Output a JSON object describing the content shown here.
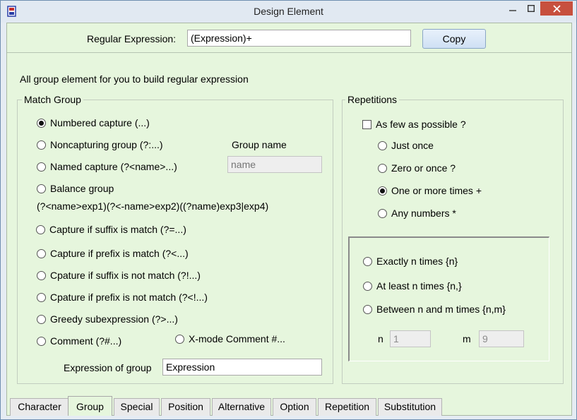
{
  "window": {
    "title": "Design Element"
  },
  "top": {
    "regex_label": "Regular Expression:",
    "regex_value": "(Expression)+",
    "copy_label": "Copy"
  },
  "intro": "All group element for you to build regular expression",
  "match_group": {
    "title": "Match Group",
    "options": [
      {
        "label": "Numbered capture  (...)",
        "checked": true
      },
      {
        "label": "Noncapturing group  (?:...)",
        "checked": false
      },
      {
        "label": "Named capture  (?<name>...)",
        "checked": false
      },
      {
        "label": "Balance group",
        "checked": false
      },
      {
        "label": "Capture if suffix is match  (?=...)",
        "checked": false
      },
      {
        "label": "Capture if prefix is match  (?<...)",
        "checked": false
      },
      {
        "label": "Cpature if suffix is not match  (?!...)",
        "checked": false
      },
      {
        "label": "Cpature if prefix is not match  (?<!...)",
        "checked": false
      },
      {
        "label": "Greedy subexpression  (?>...)",
        "checked": false
      },
      {
        "label": "Comment  (?#...)",
        "checked": false
      },
      {
        "label": "X-mode Comment  #...",
        "checked": false
      }
    ],
    "balance_detail": "(?<name>exp1)(?<-name>exp2)((?name)exp3|exp4)",
    "group_name_label": "Group name",
    "group_name_placeholder": "name",
    "expression_label": "Expression of group",
    "expression_value": "Expression"
  },
  "repetitions": {
    "title": "Repetitions",
    "as_few_label": "As few as possible  ?",
    "as_few_checked": false,
    "options": [
      {
        "label": "Just once",
        "checked": false
      },
      {
        "label": "Zero or once  ?",
        "checked": false
      },
      {
        "label": "One or more times  +",
        "checked": true
      },
      {
        "label": "Any numbers  *",
        "checked": false
      },
      {
        "label": "Exactly n times  {n}",
        "checked": false
      },
      {
        "label": "At least n times  {n,}",
        "checked": false
      },
      {
        "label": "Between n and m times {n,m}",
        "checked": false
      }
    ],
    "n_label": "n",
    "n_value": "1",
    "m_label": "m",
    "m_value": "9"
  },
  "tabs": [
    {
      "label": "Character",
      "active": false
    },
    {
      "label": "Group",
      "active": true
    },
    {
      "label": "Special",
      "active": false
    },
    {
      "label": "Position",
      "active": false
    },
    {
      "label": "Alternative",
      "active": false
    },
    {
      "label": "Option",
      "active": false
    },
    {
      "label": "Repetition",
      "active": false
    },
    {
      "label": "Substitution",
      "active": false
    }
  ],
  "colors": {
    "accent": "#c7503e",
    "panel": "#e6f6dd",
    "titlebar": "#e1e9f2"
  }
}
